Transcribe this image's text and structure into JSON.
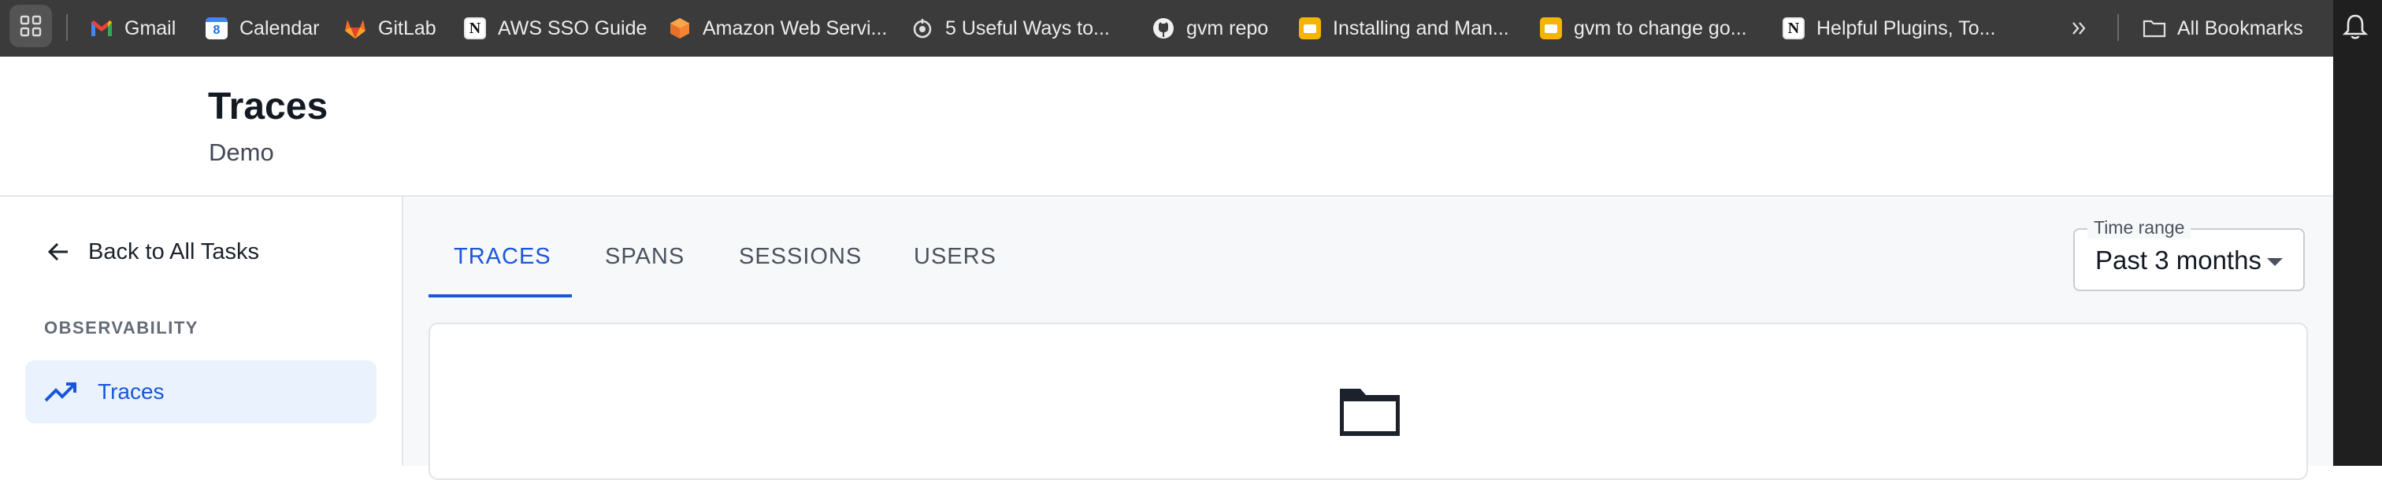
{
  "bookmarks": {
    "items": [
      {
        "label": "Gmail",
        "icon": "gmail-icon"
      },
      {
        "label": "Calendar",
        "icon": "calendar-icon"
      },
      {
        "label": "GitLab",
        "icon": "gitlab-icon"
      },
      {
        "label": "AWS SSO Guide",
        "icon": "notion-icon"
      },
      {
        "label": "Amazon Web Servi...",
        "icon": "aws-icon"
      },
      {
        "label": "5 Useful Ways to...",
        "icon": "target-icon"
      },
      {
        "label": "gvm repo",
        "icon": "github-icon"
      },
      {
        "label": "Installing and Man...",
        "icon": "slides-icon"
      },
      {
        "label": "gvm to change go...",
        "icon": "slides-icon"
      },
      {
        "label": "Helpful Plugins, To...",
        "icon": "notion-icon"
      }
    ],
    "all_bookmarks": "All Bookmarks",
    "calendar_day": "8",
    "notion_letter": "N"
  },
  "header": {
    "title": "Traces",
    "subtitle": "Demo"
  },
  "sidebar": {
    "back_label": "Back to All Tasks",
    "section_label": "OBSERVABILITY",
    "items": [
      {
        "label": "Traces",
        "active": true
      }
    ]
  },
  "main": {
    "tabs": [
      {
        "label": "TRACES",
        "active": true
      },
      {
        "label": "SPANS",
        "active": false
      },
      {
        "label": "SESSIONS",
        "active": false
      },
      {
        "label": "USERS",
        "active": false
      }
    ],
    "time_range": {
      "label": "Time range",
      "value": "Past 3 months"
    }
  },
  "colors": {
    "accent": "#1a56db",
    "bookmark_bar": "#3b3b3b",
    "active_nav_bg": "#e9f2fd"
  }
}
